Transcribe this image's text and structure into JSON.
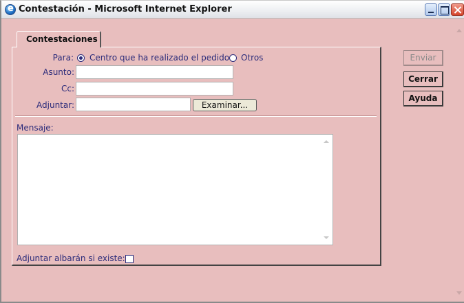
{
  "window": {
    "title": "Contestación - Microsoft Internet Explorer",
    "icons": [
      "ie-icon",
      "minimize-icon",
      "maximize-icon",
      "close-icon"
    ]
  },
  "tab": {
    "label": "Contestaciones"
  },
  "form": {
    "para_label": "Para:",
    "para_option_1": "Centro que ha realizado el pedido",
    "para_option_2": "Otros",
    "asunto_label": "Asunto:",
    "asunto_value": "",
    "cc_label": "Cc:",
    "cc_value": "",
    "adjuntar_label": "Adjuntar:",
    "adjuntar_value": "",
    "browse_label": "Examinar...",
    "mensaje_label": "Mensaje:",
    "mensaje_value": "",
    "albaran_label": "Adjuntar albarán si existe:"
  },
  "buttons": {
    "enviar": "Enviar",
    "cerrar": "Cerrar",
    "ayuda": "Ayuda"
  },
  "colors": {
    "background": "#e8bebe",
    "label": "#2b2b7a"
  }
}
